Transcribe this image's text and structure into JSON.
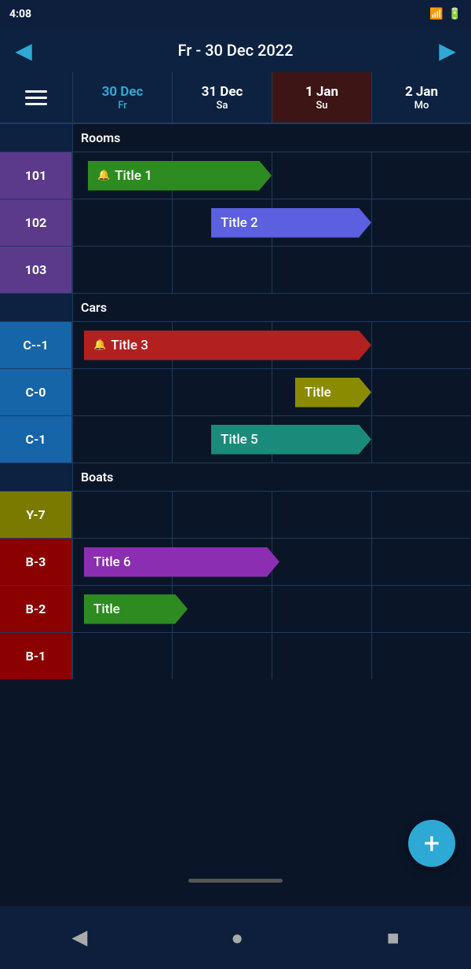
{
  "statusBar": {
    "time": "4:08",
    "icons": [
      "●",
      "▲",
      "▬",
      "▲",
      "▮"
    ]
  },
  "header": {
    "date": "Fr - 30 Dec 2022",
    "prevArrow": "◀",
    "nextArrow": "▶"
  },
  "columns": [
    {
      "id": "col-30dec",
      "dayNum": "30 Dec",
      "dayName": "Fr",
      "active": true,
      "sunday": false
    },
    {
      "id": "col-31dec",
      "dayNum": "31 Dec",
      "dayName": "Sa",
      "active": false,
      "sunday": false
    },
    {
      "id": "col-1jan",
      "dayNum": "1 Jan",
      "dayName": "Su",
      "active": false,
      "sunday": true
    },
    {
      "id": "col-2jan",
      "dayNum": "2 Jan",
      "dayName": "Mo",
      "active": false,
      "sunday": false
    }
  ],
  "sections": [
    {
      "id": "rooms",
      "label": "Rooms",
      "resources": [
        {
          "id": "101",
          "label": "101",
          "colorClass": "purple",
          "events": [
            {
              "id": "title1",
              "title": "Title 1",
              "colorClass": "green",
              "hasBell": true,
              "startCol": 0,
              "startOffset": 20,
              "endCol": 2,
              "endOffset": 0,
              "arrowType": "arrow-right"
            }
          ]
        },
        {
          "id": "102",
          "label": "102",
          "colorClass": "purple",
          "events": [
            {
              "id": "title2",
              "title": "Title 2",
              "colorClass": "blue-violet",
              "hasBell": false,
              "startCol": 1,
              "startOffset": 50,
              "endCol": 3,
              "endOffset": 0,
              "arrowType": "arrow-right"
            }
          ]
        },
        {
          "id": "103",
          "label": "103",
          "colorClass": "purple",
          "events": []
        }
      ]
    },
    {
      "id": "cars",
      "label": "Cars",
      "resources": [
        {
          "id": "C--1",
          "label": "C--1",
          "colorClass": "blue",
          "events": [
            {
              "id": "title3",
              "title": "Title 3",
              "colorClass": "red",
              "hasBell": true,
              "startCol": 0,
              "startOffset": 15,
              "endCol": 3,
              "endOffset": 0,
              "arrowType": "arrow-right"
            }
          ]
        },
        {
          "id": "C-0",
          "label": "C-0",
          "colorClass": "blue",
          "events": [
            {
              "id": "title4",
              "title": "Title",
              "colorClass": "olive-yellow",
              "hasBell": false,
              "startCol": 2,
              "startOffset": 30,
              "endCol": 3,
              "endOffset": 0,
              "arrowType": "arrow-right"
            }
          ]
        },
        {
          "id": "C-1",
          "label": "C-1",
          "colorClass": "blue",
          "events": [
            {
              "id": "title5",
              "title": "Title 5",
              "colorClass": "teal",
              "hasBell": false,
              "startCol": 1,
              "startOffset": 50,
              "endCol": 3,
              "endOffset": 0,
              "arrowType": "arrow-right"
            }
          ]
        }
      ]
    },
    {
      "id": "boats",
      "label": "Boats",
      "resources": [
        {
          "id": "Y-7",
          "label": "Y-7",
          "colorClass": "olive",
          "events": []
        },
        {
          "id": "B-3",
          "label": "B-3",
          "colorClass": "darkred",
          "events": [
            {
              "id": "title6",
              "title": "Title 6",
              "colorClass": "purple",
              "hasBell": false,
              "startCol": 0,
              "startOffset": 15,
              "endCol": 2,
              "endOffset": 10,
              "arrowType": "arrow-right"
            }
          ]
        },
        {
          "id": "B-2",
          "label": "B-2",
          "colorClass": "darkred",
          "events": [
            {
              "id": "title7",
              "title": "Title",
              "colorClass": "green2",
              "hasBell": false,
              "startCol": 0,
              "startOffset": 15,
              "endCol": 1,
              "endOffset": 20,
              "arrowType": "arrow-right"
            }
          ]
        },
        {
          "id": "B-1",
          "label": "B-1",
          "colorClass": "darkred",
          "events": []
        }
      ]
    }
  ],
  "fab": {
    "label": "+"
  },
  "bottomNav": {
    "back": "◀",
    "home": "●",
    "recent": "■"
  }
}
